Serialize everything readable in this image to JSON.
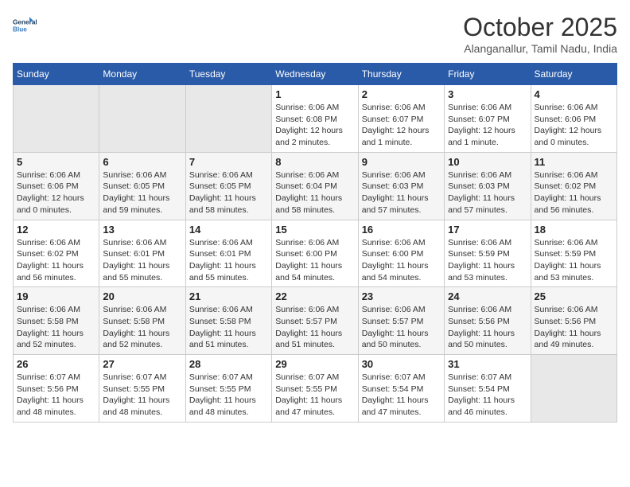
{
  "logo": {
    "line1": "General",
    "line2": "Blue"
  },
  "title": "October 2025",
  "subtitle": "Alanganallur, Tamil Nadu, India",
  "weekdays": [
    "Sunday",
    "Monday",
    "Tuesday",
    "Wednesday",
    "Thursday",
    "Friday",
    "Saturday"
  ],
  "weeks": [
    [
      {
        "day": "",
        "info": ""
      },
      {
        "day": "",
        "info": ""
      },
      {
        "day": "",
        "info": ""
      },
      {
        "day": "1",
        "info": "Sunrise: 6:06 AM\nSunset: 6:08 PM\nDaylight: 12 hours\nand 2 minutes."
      },
      {
        "day": "2",
        "info": "Sunrise: 6:06 AM\nSunset: 6:07 PM\nDaylight: 12 hours\nand 1 minute."
      },
      {
        "day": "3",
        "info": "Sunrise: 6:06 AM\nSunset: 6:07 PM\nDaylight: 12 hours\nand 1 minute."
      },
      {
        "day": "4",
        "info": "Sunrise: 6:06 AM\nSunset: 6:06 PM\nDaylight: 12 hours\nand 0 minutes."
      }
    ],
    [
      {
        "day": "5",
        "info": "Sunrise: 6:06 AM\nSunset: 6:06 PM\nDaylight: 12 hours\nand 0 minutes."
      },
      {
        "day": "6",
        "info": "Sunrise: 6:06 AM\nSunset: 6:05 PM\nDaylight: 11 hours\nand 59 minutes."
      },
      {
        "day": "7",
        "info": "Sunrise: 6:06 AM\nSunset: 6:05 PM\nDaylight: 11 hours\nand 58 minutes."
      },
      {
        "day": "8",
        "info": "Sunrise: 6:06 AM\nSunset: 6:04 PM\nDaylight: 11 hours\nand 58 minutes."
      },
      {
        "day": "9",
        "info": "Sunrise: 6:06 AM\nSunset: 6:03 PM\nDaylight: 11 hours\nand 57 minutes."
      },
      {
        "day": "10",
        "info": "Sunrise: 6:06 AM\nSunset: 6:03 PM\nDaylight: 11 hours\nand 57 minutes."
      },
      {
        "day": "11",
        "info": "Sunrise: 6:06 AM\nSunset: 6:02 PM\nDaylight: 11 hours\nand 56 minutes."
      }
    ],
    [
      {
        "day": "12",
        "info": "Sunrise: 6:06 AM\nSunset: 6:02 PM\nDaylight: 11 hours\nand 56 minutes."
      },
      {
        "day": "13",
        "info": "Sunrise: 6:06 AM\nSunset: 6:01 PM\nDaylight: 11 hours\nand 55 minutes."
      },
      {
        "day": "14",
        "info": "Sunrise: 6:06 AM\nSunset: 6:01 PM\nDaylight: 11 hours\nand 55 minutes."
      },
      {
        "day": "15",
        "info": "Sunrise: 6:06 AM\nSunset: 6:00 PM\nDaylight: 11 hours\nand 54 minutes."
      },
      {
        "day": "16",
        "info": "Sunrise: 6:06 AM\nSunset: 6:00 PM\nDaylight: 11 hours\nand 54 minutes."
      },
      {
        "day": "17",
        "info": "Sunrise: 6:06 AM\nSunset: 5:59 PM\nDaylight: 11 hours\nand 53 minutes."
      },
      {
        "day": "18",
        "info": "Sunrise: 6:06 AM\nSunset: 5:59 PM\nDaylight: 11 hours\nand 53 minutes."
      }
    ],
    [
      {
        "day": "19",
        "info": "Sunrise: 6:06 AM\nSunset: 5:58 PM\nDaylight: 11 hours\nand 52 minutes."
      },
      {
        "day": "20",
        "info": "Sunrise: 6:06 AM\nSunset: 5:58 PM\nDaylight: 11 hours\nand 52 minutes."
      },
      {
        "day": "21",
        "info": "Sunrise: 6:06 AM\nSunset: 5:58 PM\nDaylight: 11 hours\nand 51 minutes."
      },
      {
        "day": "22",
        "info": "Sunrise: 6:06 AM\nSunset: 5:57 PM\nDaylight: 11 hours\nand 51 minutes."
      },
      {
        "day": "23",
        "info": "Sunrise: 6:06 AM\nSunset: 5:57 PM\nDaylight: 11 hours\nand 50 minutes."
      },
      {
        "day": "24",
        "info": "Sunrise: 6:06 AM\nSunset: 5:56 PM\nDaylight: 11 hours\nand 50 minutes."
      },
      {
        "day": "25",
        "info": "Sunrise: 6:06 AM\nSunset: 5:56 PM\nDaylight: 11 hours\nand 49 minutes."
      }
    ],
    [
      {
        "day": "26",
        "info": "Sunrise: 6:07 AM\nSunset: 5:56 PM\nDaylight: 11 hours\nand 48 minutes."
      },
      {
        "day": "27",
        "info": "Sunrise: 6:07 AM\nSunset: 5:55 PM\nDaylight: 11 hours\nand 48 minutes."
      },
      {
        "day": "28",
        "info": "Sunrise: 6:07 AM\nSunset: 5:55 PM\nDaylight: 11 hours\nand 48 minutes."
      },
      {
        "day": "29",
        "info": "Sunrise: 6:07 AM\nSunset: 5:55 PM\nDaylight: 11 hours\nand 47 minutes."
      },
      {
        "day": "30",
        "info": "Sunrise: 6:07 AM\nSunset: 5:54 PM\nDaylight: 11 hours\nand 47 minutes."
      },
      {
        "day": "31",
        "info": "Sunrise: 6:07 AM\nSunset: 5:54 PM\nDaylight: 11 hours\nand 46 minutes."
      },
      {
        "day": "",
        "info": ""
      }
    ]
  ]
}
